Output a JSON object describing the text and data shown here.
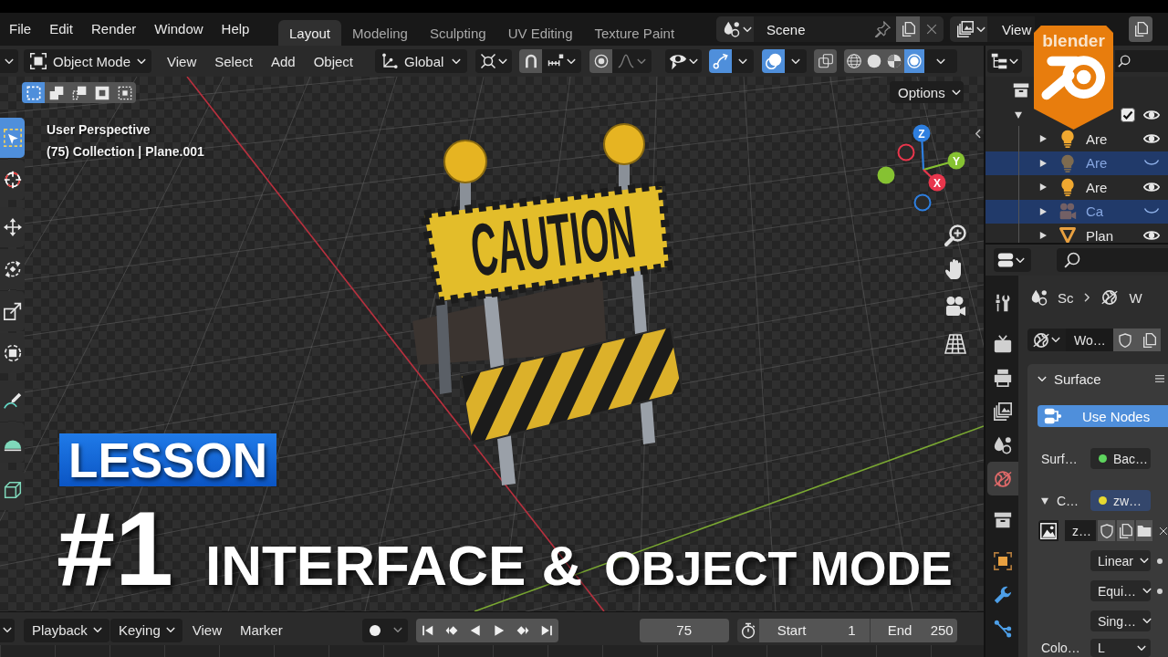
{
  "menu_bar": {
    "menus": [
      "File",
      "Edit",
      "Render",
      "Window",
      "Help"
    ],
    "workspaces": [
      {
        "label": "Layout",
        "selected": true
      },
      {
        "label": "Modeling",
        "selected": false
      },
      {
        "label": "Sculpting",
        "selected": false
      },
      {
        "label": "UV Editing",
        "selected": false
      },
      {
        "label": "Texture Paint",
        "selected": false
      }
    ],
    "scene": "Scene",
    "view_layer": "View"
  },
  "logo_badge": {
    "text": "blender"
  },
  "viewport_header": {
    "mode": "Object Mode",
    "menus": [
      "View",
      "Select",
      "Add",
      "Object"
    ],
    "orientation": "Global",
    "snap": {
      "on": false
    },
    "proportional_editing": {
      "on": false
    },
    "gizmos": {
      "on": true
    },
    "overlays": {
      "on": true
    },
    "xray": {
      "on": false
    },
    "shading_modes": [
      {
        "selected": false
      },
      {
        "selected": false
      },
      {
        "selected": false
      },
      {
        "selected": true
      }
    ]
  },
  "viewport": {
    "select_modes": [
      {
        "selected": true
      },
      {
        "selected": false
      },
      {
        "selected": false
      },
      {
        "selected": false
      },
      {
        "selected": false
      }
    ],
    "options": "Options",
    "tools": [
      {
        "selected": true
      },
      {
        "selected": false
      },
      {
        "selected": false
      },
      {
        "selected": false
      },
      {
        "selected": false
      },
      {
        "selected": false
      },
      {
        "selected": false
      },
      {
        "selected": false
      },
      {
        "selected": false
      }
    ],
    "info": [
      "User Perspective",
      "(75) Collection | Plane.001"
    ],
    "gizmo_axes": [
      {
        "label": "Z",
        "color": "#2e7fe0"
      },
      {
        "label": "Y",
        "color": "#86c232"
      },
      {
        "label": "X",
        "color": "#e8364c"
      }
    ],
    "sign_text": "CAUTION"
  },
  "title_overlay": {
    "badge": "LESSON",
    "number": "#1",
    "lead": "INTERFACE &",
    "rest": "OBJECT MODE"
  },
  "outliner": {
    "collection": {
      "expanded": true,
      "checked": true,
      "visible": true
    },
    "rows": [
      {
        "label": "Are",
        "kind": "light",
        "expanded": false,
        "selected": false,
        "visible": true
      },
      {
        "label": "Are",
        "kind": "light",
        "expanded": false,
        "selected": true,
        "visible": false
      },
      {
        "label": "Are",
        "kind": "light",
        "expanded": false,
        "selected": false,
        "visible": true
      },
      {
        "label": "Ca",
        "kind": "camera",
        "expanded": false,
        "selected": true,
        "visible": false
      },
      {
        "label": "Plan",
        "kind": "mesh",
        "expanded": false,
        "selected": false,
        "visible": true
      }
    ]
  },
  "properties": {
    "tabs": [
      {
        "selected": false
      },
      {
        "selected": false
      },
      {
        "selected": false
      },
      {
        "selected": false
      },
      {
        "selected": false
      },
      {
        "selected": true
      },
      {
        "selected": false
      },
      {
        "selected": false
      },
      {
        "selected": false
      },
      {
        "selected": false
      }
    ],
    "breadcrumb": [
      "Sc",
      "W"
    ],
    "world": "Wo…",
    "panel": {
      "title": "Surface",
      "expanded": true
    },
    "use_nodes": "Use Nodes",
    "rows": [
      {
        "kind": "socket",
        "label": "Surf…",
        "value": "Bac…",
        "color": "#5ed45e",
        "linked": false
      },
      {
        "kind": "socket",
        "label": "C…",
        "value": "zw…",
        "color": "#e6d931",
        "linked": true,
        "expanded": true
      },
      {
        "kind": "image",
        "value": "z…"
      },
      {
        "kind": "dropdown",
        "value": "Linear",
        "keyframe": true
      },
      {
        "kind": "dropdown",
        "value": "Equi…",
        "keyframe": true
      },
      {
        "kind": "dropdown",
        "value": "Sing…"
      },
      {
        "kind": "dropdown",
        "label": "Colo…",
        "value": "L"
      }
    ]
  },
  "timeline": {
    "menus": [
      {
        "label": "Playback",
        "kind": "dropdown"
      },
      {
        "label": "Keying",
        "kind": "dropdown"
      },
      {
        "label": "View",
        "kind": "menu"
      },
      {
        "label": "Marker",
        "kind": "menu"
      }
    ],
    "auto_keying": {
      "on": false
    },
    "current_frame": "75",
    "start": {
      "label": "Start",
      "value": "1"
    },
    "end": {
      "label": "End",
      "value": "250"
    }
  }
}
